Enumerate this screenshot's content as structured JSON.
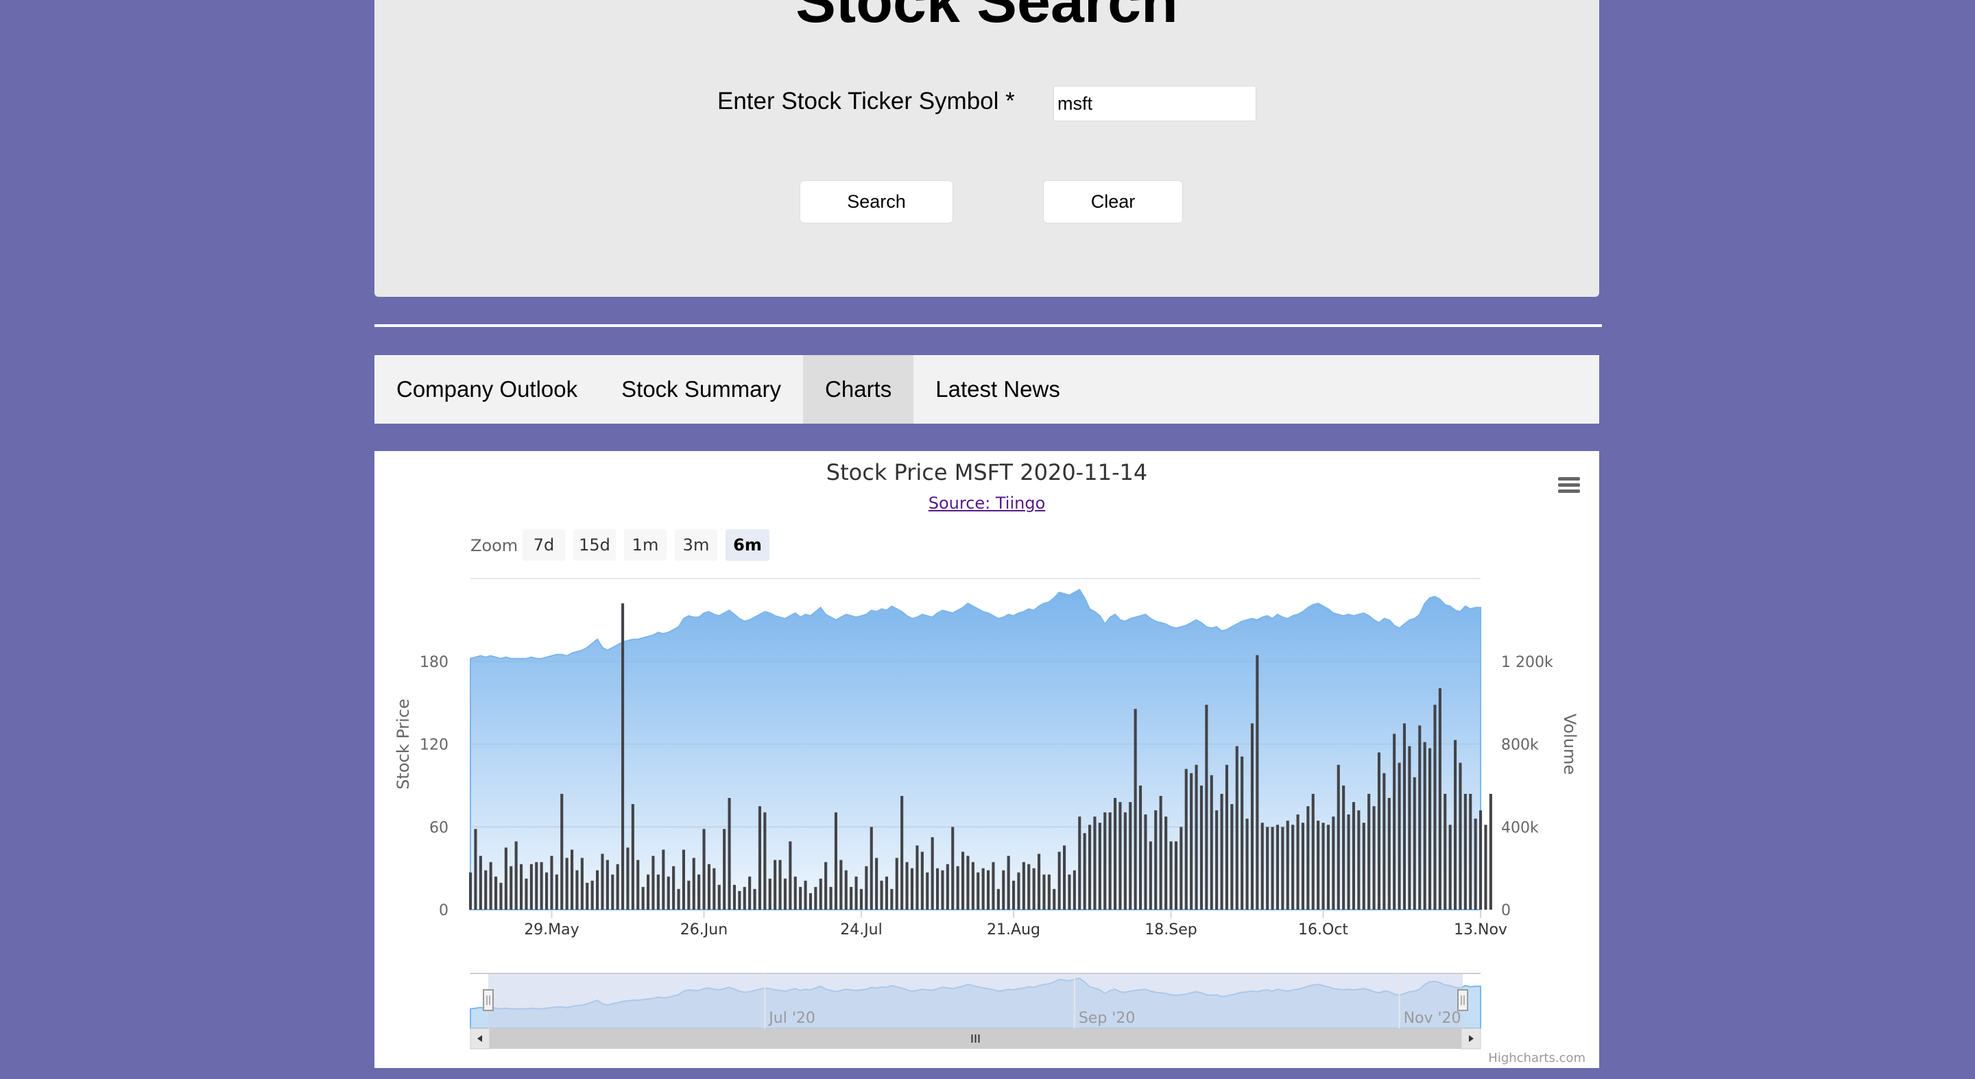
{
  "search": {
    "title": "Stock Search",
    "ticker_label": "Enter Stock Ticker Symbol *",
    "ticker_value": "msft",
    "search_label": "Search",
    "clear_label": "Clear"
  },
  "tabs": [
    "Company Outlook",
    "Stock Summary",
    "Charts",
    "Latest News"
  ],
  "active_tab": "Charts",
  "chart": {
    "title": "Stock Price MSFT 2020-11-14",
    "subtitle": "Source: Tiingo",
    "zoom_label": "Zoom",
    "zoom_buttons": [
      "7d",
      "15d",
      "1m",
      "3m",
      "6m"
    ],
    "active_zoom": "6m",
    "credits": "Highcharts.com",
    "menu_icon": "hamburger-menu-icon"
  },
  "chart_data": {
    "type": "area",
    "left_axis": {
      "title": "Stock Price",
      "ticks": [
        "0",
        "60",
        "120",
        "180"
      ],
      "range": [
        0,
        240
      ]
    },
    "right_axis": {
      "title": "Volume",
      "ticks": [
        "0",
        "400k",
        "800k",
        "1 200k"
      ],
      "range": [
        0,
        1600000
      ]
    },
    "x_ticks": [
      "29.May",
      "26.Jun",
      "24.Jul",
      "21.Aug",
      "18.Sep",
      "16.Oct",
      "13.Nov"
    ],
    "navigator_ticks": [
      "Jul '20",
      "Sep '20",
      "Nov '20"
    ],
    "colors": {
      "price_area": "#7cb5ec",
      "volume_bars": "#434348",
      "navigator_mask": "#ccd6eb"
    },
    "price": [
      182,
      183,
      184,
      183,
      184,
      183,
      182,
      183,
      182,
      182,
      182,
      182,
      183,
      182,
      182,
      183,
      184,
      185,
      185,
      184,
      186,
      187,
      188,
      190,
      193,
      196,
      190,
      188,
      190,
      192,
      194,
      195,
      196,
      196,
      197,
      198,
      199,
      201,
      200,
      201,
      203,
      205,
      211,
      213,
      212,
      212,
      215,
      216,
      214,
      213,
      215,
      217,
      214,
      211,
      209,
      210,
      212,
      214,
      216,
      215,
      213,
      212,
      211,
      213,
      215,
      212,
      214,
      213,
      216,
      219,
      214,
      212,
      210,
      212,
      214,
      213,
      212,
      213,
      214,
      217,
      216,
      218,
      217,
      220,
      218,
      216,
      213,
      211,
      212,
      214,
      213,
      212,
      215,
      217,
      216,
      215,
      217,
      219,
      222,
      220,
      218,
      216,
      215,
      213,
      211,
      212,
      214,
      213,
      215,
      216,
      218,
      217,
      220,
      222,
      223,
      226,
      230,
      229,
      228,
      230,
      232,
      226,
      218,
      216,
      213,
      207,
      212,
      214,
      210,
      209,
      211,
      212,
      213,
      214,
      211,
      209,
      208,
      207,
      205,
      204,
      205,
      206,
      208,
      210,
      208,
      205,
      204,
      205,
      202,
      203,
      205,
      207,
      209,
      210,
      211,
      210,
      212,
      213,
      211,
      214,
      212,
      211,
      213,
      214,
      216,
      219,
      221,
      222,
      220,
      218,
      215,
      214,
      213,
      214,
      213,
      214,
      215,
      213,
      210,
      208,
      211,
      210,
      206,
      204,
      207,
      210,
      211,
      214,
      222,
      226,
      227,
      225,
      221,
      220,
      217,
      216,
      220,
      218,
      219,
      219
    ],
    "volume": [
      180000,
      390000,
      260000,
      190000,
      230000,
      160000,
      130000,
      300000,
      210000,
      330000,
      220000,
      150000,
      220000,
      230000,
      230000,
      180000,
      260000,
      170000,
      560000,
      250000,
      290000,
      190000,
      250000,
      130000,
      140000,
      190000,
      270000,
      240000,
      170000,
      220000,
      1480000,
      300000,
      510000,
      240000,
      110000,
      170000,
      260000,
      170000,
      290000,
      160000,
      210000,
      100000,
      290000,
      140000,
      250000,
      170000,
      390000,
      220000,
      200000,
      120000,
      390000,
      540000,
      120000,
      90000,
      110000,
      160000,
      100000,
      500000,
      470000,
      150000,
      240000,
      240000,
      150000,
      330000,
      160000,
      110000,
      140000,
      80000,
      110000,
      150000,
      230000,
      110000,
      470000,
      240000,
      190000,
      110000,
      160000,
      100000,
      210000,
      400000,
      250000,
      140000,
      160000,
      100000,
      250000,
      550000,
      230000,
      200000,
      310000,
      280000,
      180000,
      350000,
      200000,
      190000,
      220000,
      400000,
      210000,
      280000,
      260000,
      230000,
      180000,
      200000,
      190000,
      230000,
      100000,
      190000,
      260000,
      140000,
      180000,
      230000,
      220000,
      200000,
      270000,
      170000,
      170000,
      100000,
      280000,
      310000,
      170000,
      190000,
      450000,
      370000,
      410000,
      450000,
      420000,
      470000,
      470000,
      540000,
      520000,
      470000,
      520000,
      970000,
      600000,
      460000,
      330000,
      480000,
      550000,
      450000,
      330000,
      330000,
      400000,
      680000,
      660000,
      700000,
      600000,
      990000,
      650000,
      480000,
      560000,
      700000,
      510000,
      790000,
      740000,
      440000,
      900000,
      1230000,
      420000,
      400000,
      400000,
      410000,
      400000,
      430000,
      410000,
      460000,
      420000,
      500000,
      560000,
      430000,
      420000,
      410000,
      450000,
      700000,
      600000,
      460000,
      520000,
      480000,
      420000,
      560000,
      500000,
      760000,
      660000,
      540000,
      850000,
      710000,
      900000,
      790000,
      640000,
      890000,
      810000,
      780000,
      990000,
      1070000,
      560000,
      410000,
      820000,
      710000,
      560000,
      560000,
      440000,
      480000,
      410000,
      560000
    ]
  }
}
